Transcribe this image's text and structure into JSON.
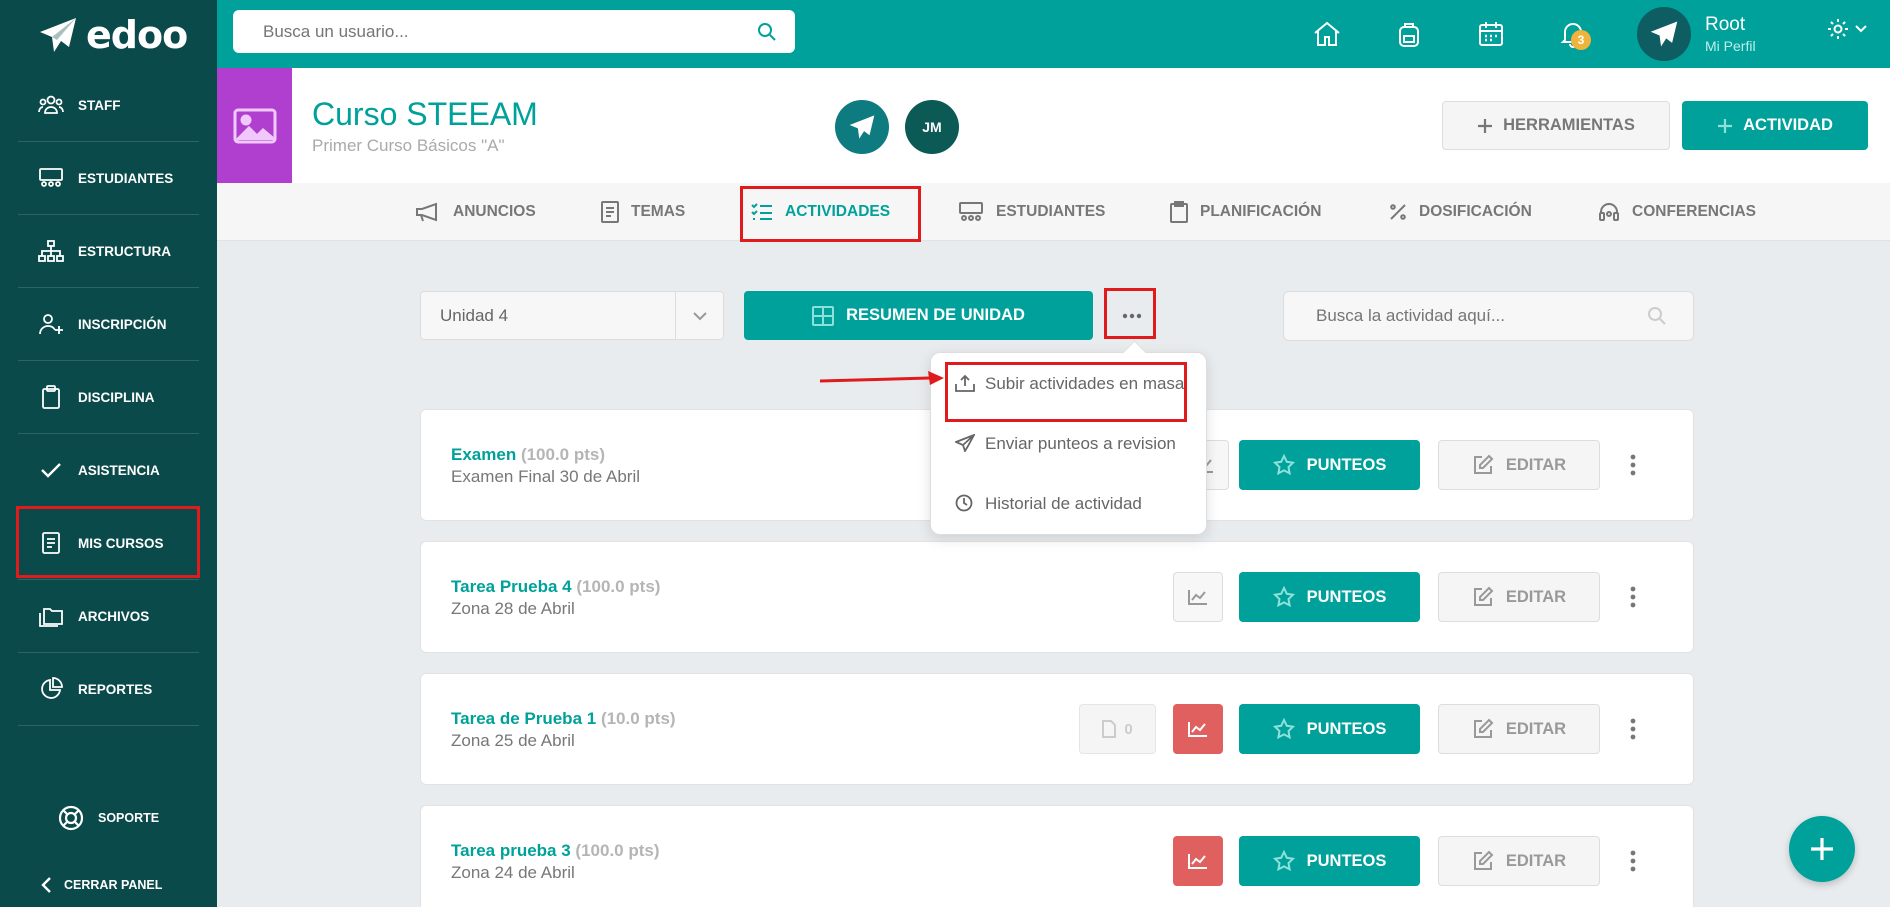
{
  "app": {
    "logo_text": "edoo"
  },
  "sidebar": {
    "items": [
      {
        "label": "STAFF",
        "icon": "users-icon"
      },
      {
        "label": "ESTUDIANTES",
        "icon": "students-icon"
      },
      {
        "label": "ESTRUCTURA",
        "icon": "sitemap-icon"
      },
      {
        "label": "INSCRIPCIÓN",
        "icon": "user-plus-icon"
      },
      {
        "label": "DISCIPLINA",
        "icon": "clipboard-icon"
      },
      {
        "label": "ASISTENCIA",
        "icon": "check-icon"
      },
      {
        "label": "MIS CURSOS",
        "icon": "book-icon"
      },
      {
        "label": "ARCHIVOS",
        "icon": "folders-icon"
      },
      {
        "label": "REPORTES",
        "icon": "pie-chart-icon"
      }
    ],
    "support_label": "SOPORTE",
    "close_label": "CERRAR PANEL"
  },
  "topbar": {
    "search_placeholder": "Busca un usuario...",
    "notifications_count": "3",
    "user_name": "Root",
    "user_sub": "Mi Perfil"
  },
  "course": {
    "title": "Curso STEEAM",
    "subtitle": "Primer Curso Básicos \"A\"",
    "member_initials": "JM",
    "tools_label": "HERRAMIENTAS",
    "activity_label": "ACTIVIDAD"
  },
  "tabs": [
    {
      "label": "ANUNCIOS"
    },
    {
      "label": "TEMAS"
    },
    {
      "label": "ACTIVIDADES"
    },
    {
      "label": "ESTUDIANTES"
    },
    {
      "label": "PLANIFICACIÓN"
    },
    {
      "label": "DOSIFICACIÓN"
    },
    {
      "label": "CONFERENCIAS"
    }
  ],
  "toolbar": {
    "unit_value": "Unidad 4",
    "resumen_label": "RESUMEN DE UNIDAD",
    "more_label": "···",
    "search_placeholder": "Busca la actividad aquí..."
  },
  "dropdown": {
    "items": [
      {
        "label": "Subir actividades en masa"
      },
      {
        "label": "Enviar punteos a revision"
      },
      {
        "label": "Historial de actividad"
      }
    ]
  },
  "activities": [
    {
      "title": "Examen",
      "points": "(100.0 pts)",
      "subtitle": "Examen Final 30 de Abril"
    },
    {
      "title": "Tarea Prueba 4",
      "points": "(100.0 pts)",
      "subtitle": "Zona 28 de Abril"
    },
    {
      "title": "Tarea de Prueba 1",
      "points": "(10.0 pts)",
      "subtitle": "Zona 25 de Abril",
      "doc_count": "0"
    },
    {
      "title": "Tarea prueba 3",
      "points": "(100.0 pts)",
      "subtitle": "Zona 24 de Abril"
    }
  ],
  "buttons": {
    "punteos": "PUNTEOS",
    "editar": "EDITAR"
  },
  "colors": {
    "primary": "#00a19a",
    "sidebar": "#0b4a4a",
    "course_image": "#b03fcf",
    "highlight": "#e01b1b",
    "stats_alert": "#e06060",
    "badge": "#f0b33b"
  }
}
